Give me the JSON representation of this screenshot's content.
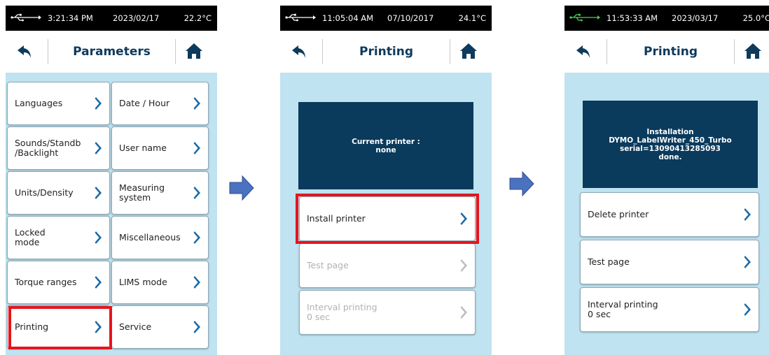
{
  "screens": [
    {
      "status": {
        "time": "3:21:34 PM",
        "date": "2023/02/17",
        "temp": "22.2°C"
      },
      "title": "Parameters",
      "grid_left": [
        "Languages",
        "Sounds/Standb\n/Backlight",
        "Units/Density",
        "Locked\nmode",
        "Torque ranges",
        "Printing"
      ],
      "grid_right": [
        "Date / Hour",
        "User name",
        "Measuring\nsystem",
        "Miscellaneous",
        "LIMS mode",
        "Service"
      ]
    },
    {
      "status": {
        "time": "11:05:04 AM",
        "date": "07/10/2017",
        "temp": "24.1°C"
      },
      "title": "Printing",
      "panel_text": "Current printer :\nnone",
      "items": [
        "Install printer",
        "Test page",
        "Interval printing\n0 sec"
      ]
    },
    {
      "status": {
        "time": "11:53:33 AM",
        "date": "2023/03/17",
        "temp": "25.0°C"
      },
      "title": "Printing",
      "panel_text": "Installation\nDYMO_LabelWriter_450_Turbo\nserial=13090413285093\ndone.",
      "items": [
        "Delete printer",
        "Test page",
        "Interval printing\n0 sec"
      ]
    }
  ],
  "colors": {
    "accent": "#0e3a5b",
    "panel": "#0a3a5c",
    "highlight": "#e8141c",
    "screen_bg": "#bfe3f0",
    "arrow": "#4a72c0"
  }
}
